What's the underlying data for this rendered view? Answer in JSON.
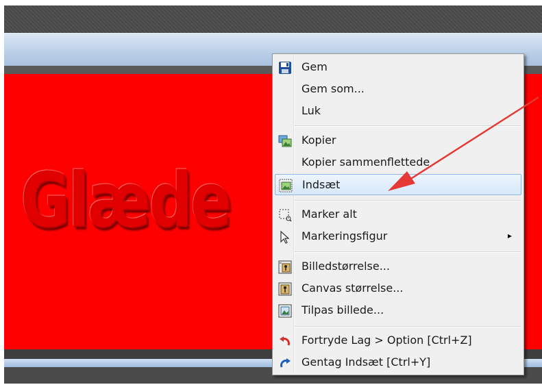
{
  "canvas": {
    "text": "Glæde",
    "background": "#ff0000"
  },
  "menu": {
    "items": [
      {
        "label": "Gem",
        "icon": "floppy-disk-icon"
      },
      {
        "label": "Gem som..."
      },
      {
        "label": "Luk"
      },
      {
        "label": "Kopier",
        "icon": "copy-image-icon"
      },
      {
        "label": "Kopier sammenflettede"
      },
      {
        "label": "Indsæt",
        "icon": "paste-image-icon",
        "highlighted": true
      },
      {
        "label": "Marker alt",
        "icon": "select-all-icon"
      },
      {
        "label": "Markeringsfigur",
        "icon": "cursor-arrow-icon",
        "submenu": true
      },
      {
        "label": "Billedstørrelse...",
        "icon": "image-size-icon"
      },
      {
        "label": "Canvas størrelse...",
        "icon": "canvas-size-icon"
      },
      {
        "label": "Tilpas billede...",
        "icon": "fit-image-icon"
      },
      {
        "label": "Fortryde Lag > Option [Ctrl+Z]",
        "icon": "undo-icon"
      },
      {
        "label": "Gentag Indsæt [Ctrl+Y]",
        "icon": "redo-icon"
      }
    ],
    "submenu_glyph": "▸",
    "highlight_color": "#d6e8fb"
  },
  "annotation": {
    "color": "#e53935",
    "icon": "red-arrow"
  }
}
